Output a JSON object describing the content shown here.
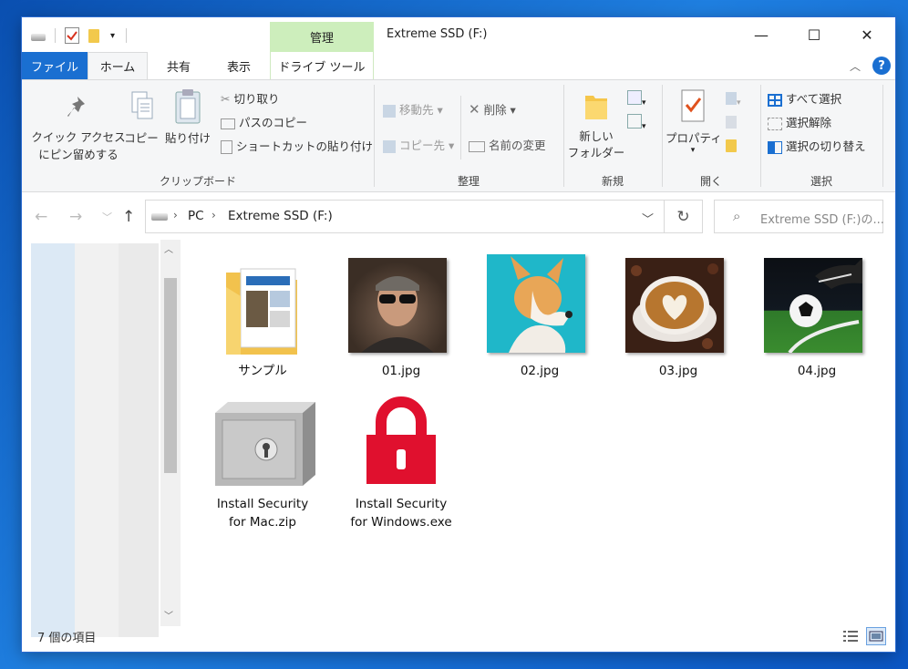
{
  "window": {
    "title": "Extreme SSD (F:)",
    "context_tab_group": "管理",
    "controls": {
      "minimize": "—",
      "maximize": "☐",
      "close": "✕"
    },
    "help": "?"
  },
  "tabs": {
    "file": "ファイル",
    "home": "ホーム",
    "share": "共有",
    "view": "表示",
    "drive_tools": "ドライブ ツール"
  },
  "ribbon": {
    "clipboard": {
      "label": "クリップボード",
      "pin_line1": "クイック アクセス",
      "pin_line2": "にピン留めする",
      "copy": "コピー",
      "paste": "貼り付け",
      "cut": "切り取り",
      "copy_path": "パスのコピー",
      "paste_shortcut": "ショートカットの貼り付け"
    },
    "organize": {
      "label": "整理",
      "move_to": "移動先",
      "copy_to": "コピー先",
      "delete": "削除",
      "rename": "名前の変更"
    },
    "new": {
      "label": "新規",
      "new_folder_line1": "新しい",
      "new_folder_line2": "フォルダー"
    },
    "open": {
      "label": "開く",
      "properties": "プロパティ"
    },
    "select": {
      "label": "選択",
      "select_all": "すべて選択",
      "select_none": "選択解除",
      "invert": "選択の切り替え"
    }
  },
  "address": {
    "crumbs": [
      "PC",
      "Extreme SSD (F:)"
    ],
    "search_placeholder": "Extreme SSD (F:)の..."
  },
  "files": [
    {
      "name": "サンプル",
      "kind": "folder"
    },
    {
      "name": "01.jpg",
      "kind": "image"
    },
    {
      "name": "02.jpg",
      "kind": "image"
    },
    {
      "name": "03.jpg",
      "kind": "image"
    },
    {
      "name": "04.jpg",
      "kind": "image"
    },
    {
      "name_line1": "Install Security",
      "name_line2": "for Mac.zip",
      "kind": "zip"
    },
    {
      "name_line1": "Install Security",
      "name_line2": "for Windows.exe",
      "kind": "exe"
    }
  ],
  "status": {
    "item_count": "7 個の項目"
  },
  "colors": {
    "accent": "#1a6fd1",
    "manage_tab": "#cdeebc",
    "lock_red": "#e0102e"
  }
}
